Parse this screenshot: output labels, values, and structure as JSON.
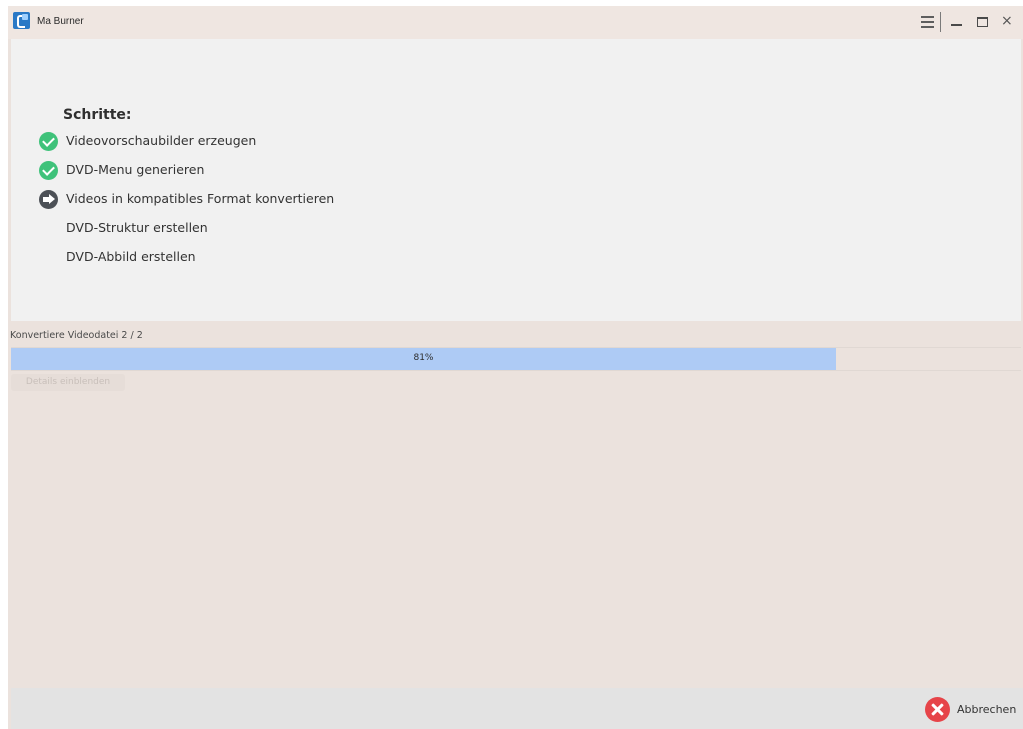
{
  "window": {
    "title": "Ma Burner"
  },
  "titlebar": {
    "menu_icon": "hamburger-menu-icon",
    "minimize_icon": "minimize-icon",
    "maximize_icon": "maximize-icon",
    "close_glyph": "×"
  },
  "steps": {
    "heading": "Schritte:",
    "items": [
      {
        "label": "Videovorschaubilder erzeugen",
        "status": "done",
        "icon": "check-circle-icon"
      },
      {
        "label": "DVD-Menu generieren",
        "status": "done",
        "icon": "check-circle-icon"
      },
      {
        "label": "Videos in kompatibles Format konvertieren",
        "status": "current",
        "icon": "arrow-circle-icon"
      },
      {
        "label": "DVD-Struktur erstellen",
        "status": "pending",
        "icon": ""
      },
      {
        "label": "DVD-Abbild erstellen",
        "status": "pending",
        "icon": ""
      }
    ]
  },
  "progress": {
    "status_text": "Konvertiere Videodatei 2 / 2",
    "percent_label": "81%",
    "fraction": 0.817,
    "details_button": "Details einblenden"
  },
  "footer": {
    "cancel_label": "Abbrechen",
    "cancel_icon": "cancel-circle-icon"
  },
  "colors": {
    "window_bg": "#ebe2dd",
    "panel_bg": "#f1f1f1",
    "progress_fill": "#aecbf5",
    "done": "#3fc27a",
    "current": "#4c5056",
    "cancel": "#e64449",
    "footer_bg": "#e3e3e3"
  }
}
